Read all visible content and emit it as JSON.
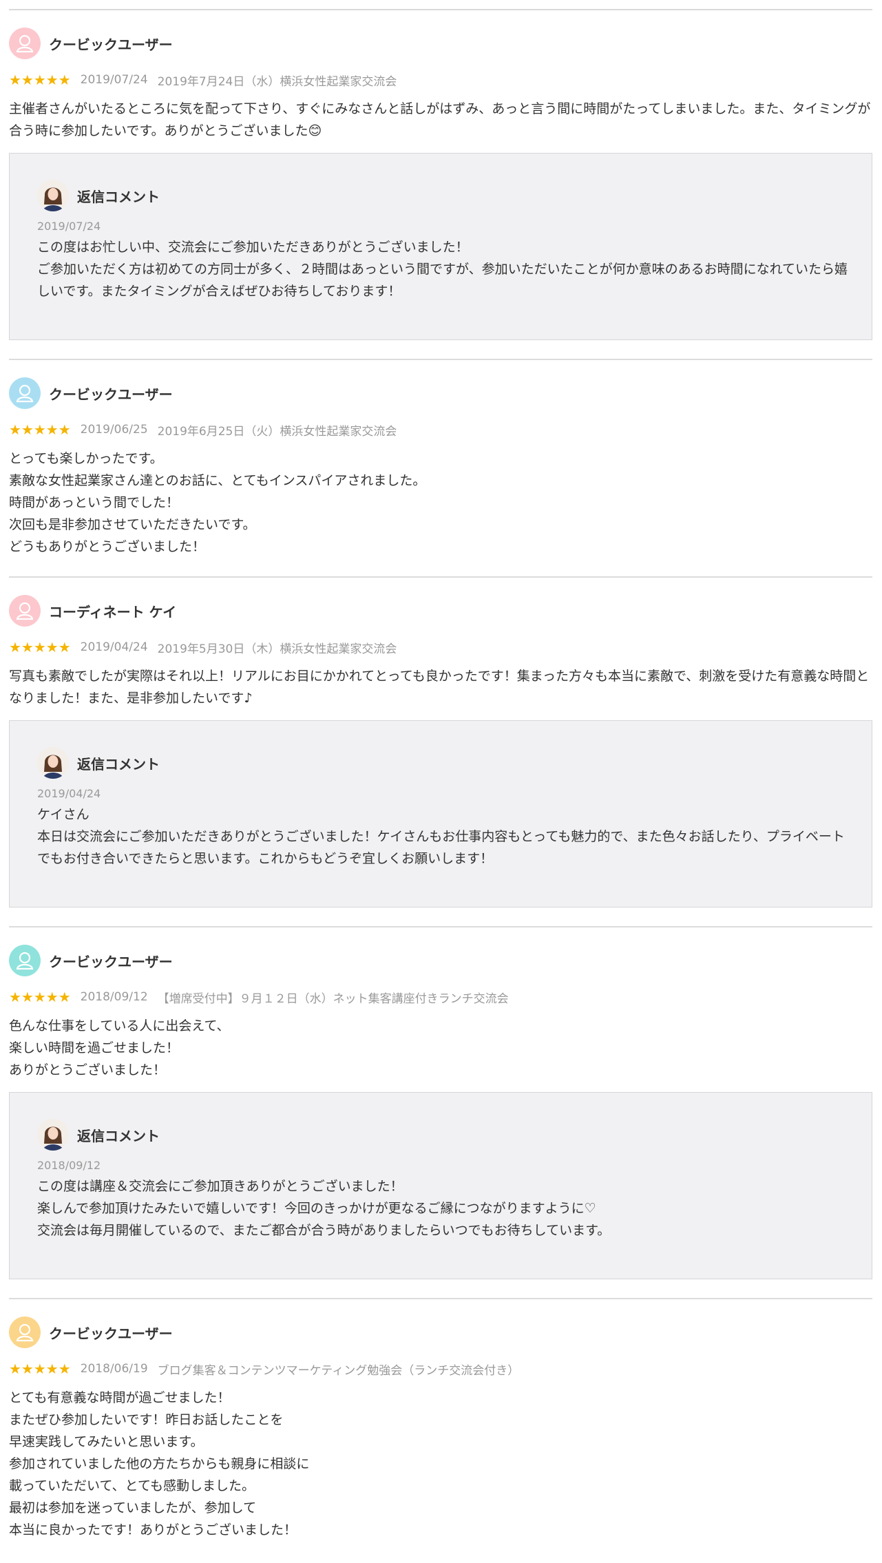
{
  "reviews": [
    {
      "user": "クービックユーザー",
      "avatar_color": "#fcc7cd",
      "stars": "★★★★★",
      "date": "2019/07/24",
      "event": "2019年7月24日（水）横浜女性起業家交流会",
      "text": "主催者さんがいたるところに気を配って下さり、すぐにみなさんと話しがはずみ、あっと言う間に時間がたってしまいました。また、タイミングが合う時に参加したいです。ありがとうございました😊",
      "reply": {
        "title": "返信コメント",
        "date": "2019/07/24",
        "text": "この度はお忙しい中、交流会にご参加いただきありがとうございました！\nご参加いただく方は初めての方同士が多く、２時間はあっという間ですが、参加いただいたことが何か意味のあるお時間になれていたら嬉しいです。またタイミングが合えばぜひお待ちしております！"
      }
    },
    {
      "user": "クービックユーザー",
      "avatar_color": "#a9def2",
      "stars": "★★★★★",
      "date": "2019/06/25",
      "event": "2019年6月25日（火）横浜女性起業家交流会",
      "text": "とっても楽しかったです。\n素敵な女性起業家さん達とのお話に、とてもインスパイアされました。\n時間があっという間でした！\n次回も是非参加させていただきたいです。\nどうもありがとうございました！"
    },
    {
      "user": "コーディネート ケイ",
      "avatar_color": "#fcc7cd",
      "stars": "★★★★★",
      "date": "2019/04/24",
      "event": "2019年5月30日（木）横浜女性起業家交流会",
      "text": "写真も素敵でしたが実際はそれ以上！リアルにお目にかかれてとっても良かったです！集まった方々も本当に素敵で、刺激を受けた有意義な時間となりました！また、是非参加したいです♪",
      "reply": {
        "title": "返信コメント",
        "date": "2019/04/24",
        "text": "ケイさん\n本日は交流会にご参加いただきありがとうございました！ケイさんもお仕事内容もとっても魅力的で、また色々お話したり、プライベートでもお付き合いできたらと思います。これからもどうぞ宜しくお願いします！"
      }
    },
    {
      "user": "クービックユーザー",
      "avatar_color": "#8fe3dc",
      "stars": "★★★★★",
      "date": "2018/09/12",
      "event": "【増席受付中】９月１２日（水）ネット集客講座付きランチ交流会",
      "text": "色んな仕事をしている人に出会えて、\n楽しい時間を過ごせました！\nありがとうございました！",
      "reply": {
        "title": "返信コメント",
        "date": "2018/09/12",
        "text": "この度は講座＆交流会にご参加頂きありがとうございました！\n楽しんで参加頂けたみたいで嬉しいです！今回のきっかけが更なるご縁につながりますように♡\n交流会は毎月開催しているので、またご都合が合う時がありましたらいつでもお待ちしています。"
      }
    },
    {
      "user": "クービックユーザー",
      "avatar_color": "#fbd58a",
      "stars": "★★★★★",
      "date": "2018/06/19",
      "event": "ブログ集客＆コンテンツマーケティング勉強会（ランチ交流会付き）",
      "text": "とても有意義な時間が過ごせました！\nまたぜひ参加したいです！昨日お話したことを\n早速実践してみたいと思います。\n参加されていました他の方たちからも親身に相談に\n載っていただいて、とても感動しました。\n最初は参加を迷っていましたが、参加して\n本当に良かったです！ありがとうございました！"
    }
  ]
}
